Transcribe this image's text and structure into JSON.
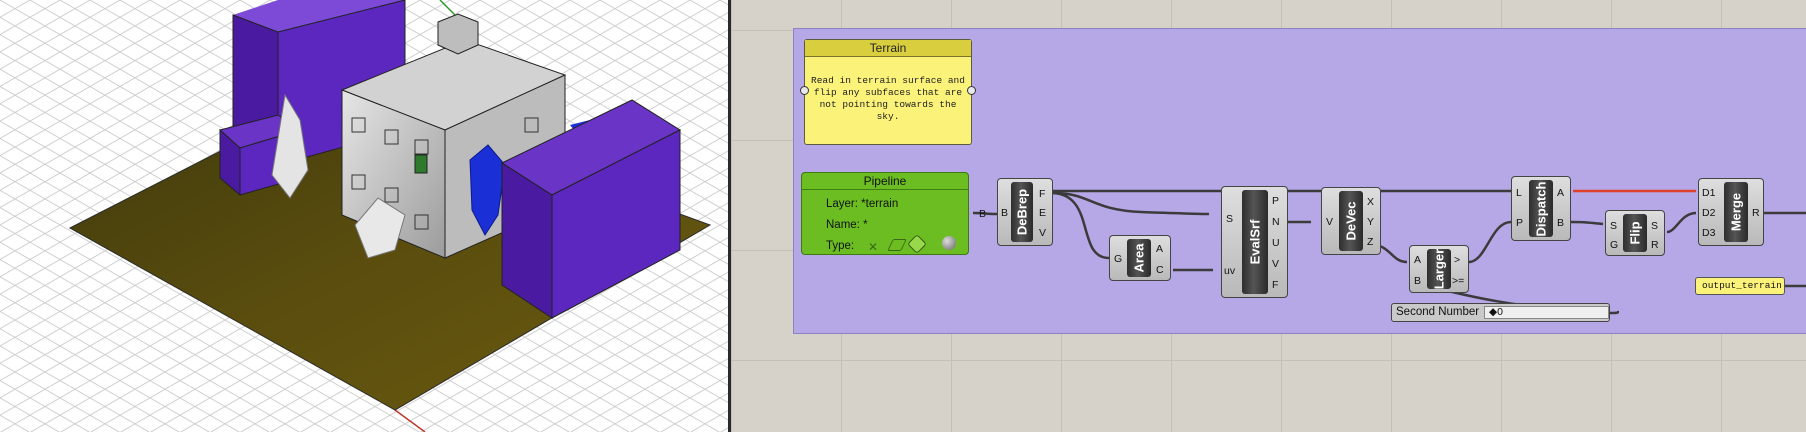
{
  "viewport": {
    "colors": {
      "ground": "#5e5010",
      "building_dark": "#4a1aa0",
      "building_light": "#6a34c7",
      "house": "#c9c9c9",
      "grid": "#c9c9c9"
    }
  },
  "canvas": {
    "group_color": "#b6a7e6",
    "terrain_panel": {
      "title": "Terrain",
      "text": "Read in terrain surface and flip any subfaces that are not pointing towards the sky."
    },
    "pipeline": {
      "title": "Pipeline",
      "layer_label": "Layer: *terrain",
      "name_label": "Name: *",
      "type_label": "Type:",
      "output": "B"
    },
    "debrep": {
      "name": "DeBrep",
      "input": "B",
      "outputs": [
        "F",
        "E",
        "V"
      ]
    },
    "area": {
      "name": "Area",
      "input": "G",
      "outputs": [
        "A",
        "C"
      ]
    },
    "evalsrf": {
      "name": "EvalSrf",
      "inputs": [
        "S",
        "uv"
      ],
      "outputs": [
        "P",
        "N",
        "U",
        "V",
        "F"
      ]
    },
    "devec": {
      "name": "DeVec",
      "input": "V",
      "outputs": [
        "X",
        "Y",
        "Z"
      ]
    },
    "larger": {
      "name": "Larger",
      "inputs": [
        "A",
        "B"
      ],
      "outputs": [
        ">",
        ">="
      ]
    },
    "dispatch": {
      "name": "Dispatch",
      "inputs": [
        "L",
        "P"
      ],
      "outputs": [
        "A",
        "B"
      ]
    },
    "flip": {
      "name": "Flip",
      "inputs": [
        "S",
        "G"
      ],
      "outputs": [
        "S",
        "R"
      ]
    },
    "merge": {
      "name": "Merge",
      "inputs": [
        "D1",
        "D2",
        "D3"
      ],
      "output": "R"
    },
    "slider": {
      "label": "Second Number",
      "value": "◆0"
    },
    "output_panel": {
      "text": "output_terrain"
    }
  }
}
